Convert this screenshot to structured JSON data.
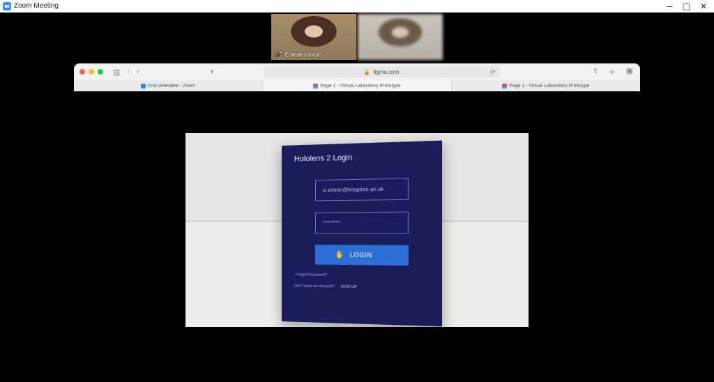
{
  "window": {
    "title": "Zoom Meeting"
  },
  "participants": [
    {
      "name": "Emese Jancsó",
      "muted": true
    },
    {
      "name": "",
      "muted": false
    }
  ],
  "safari": {
    "address_host": "figma.com",
    "tabs": [
      {
        "label": "Post Attendee - Zoom",
        "icon": "zoom",
        "active": false
      },
      {
        "label": "Page 1 - Virtual Laboratory Prototype",
        "icon": "figma",
        "active": true
      },
      {
        "label": "Page 1 - Virtual Laboratory Prototype",
        "icon": "figma",
        "active": false
      }
    ]
  },
  "hololens": {
    "title": "Hololens 2 Login",
    "email": "o.wilson@kingston.ac.uk",
    "password_masked": "********",
    "login_label": "LOGIN",
    "forgot_label": "Forgot Password?",
    "no_account_label": "Don't have an account?",
    "signup_label": "SIGN UP"
  }
}
